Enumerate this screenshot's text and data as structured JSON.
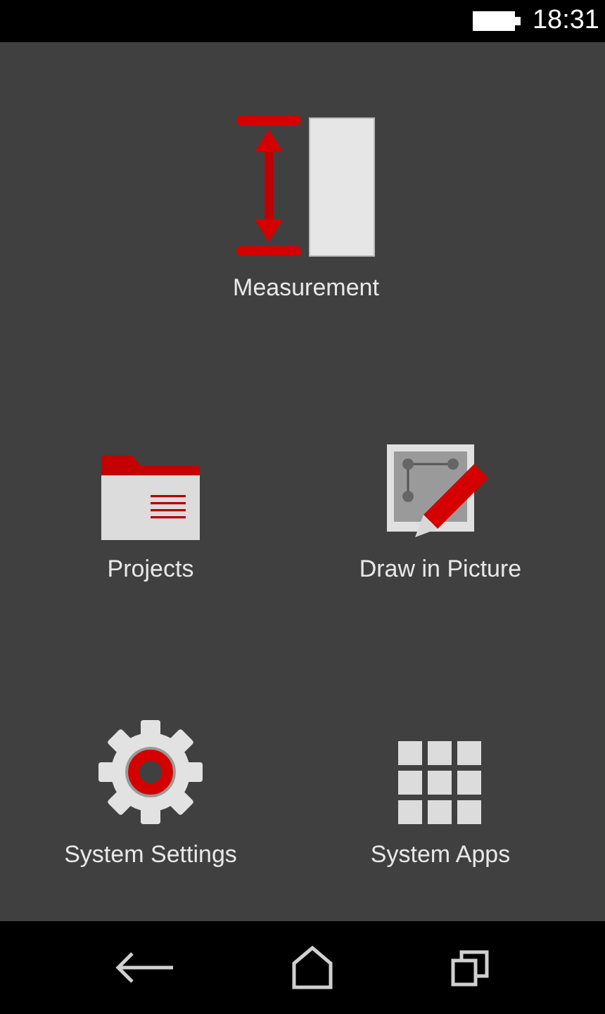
{
  "status_bar": {
    "time": "18:31"
  },
  "featured": {
    "kind": "measurement",
    "label": "Measurement"
  },
  "apps": [
    {
      "kind": "folder",
      "label": "Projects"
    },
    {
      "kind": "draw",
      "label": "Draw in Picture"
    },
    {
      "kind": "settings",
      "label": "System Settings"
    },
    {
      "kind": "grid",
      "label": "System Apps"
    }
  ],
  "nav_bar": [
    {
      "kind": "back"
    },
    {
      "kind": "home"
    },
    {
      "kind": "recents"
    }
  ]
}
